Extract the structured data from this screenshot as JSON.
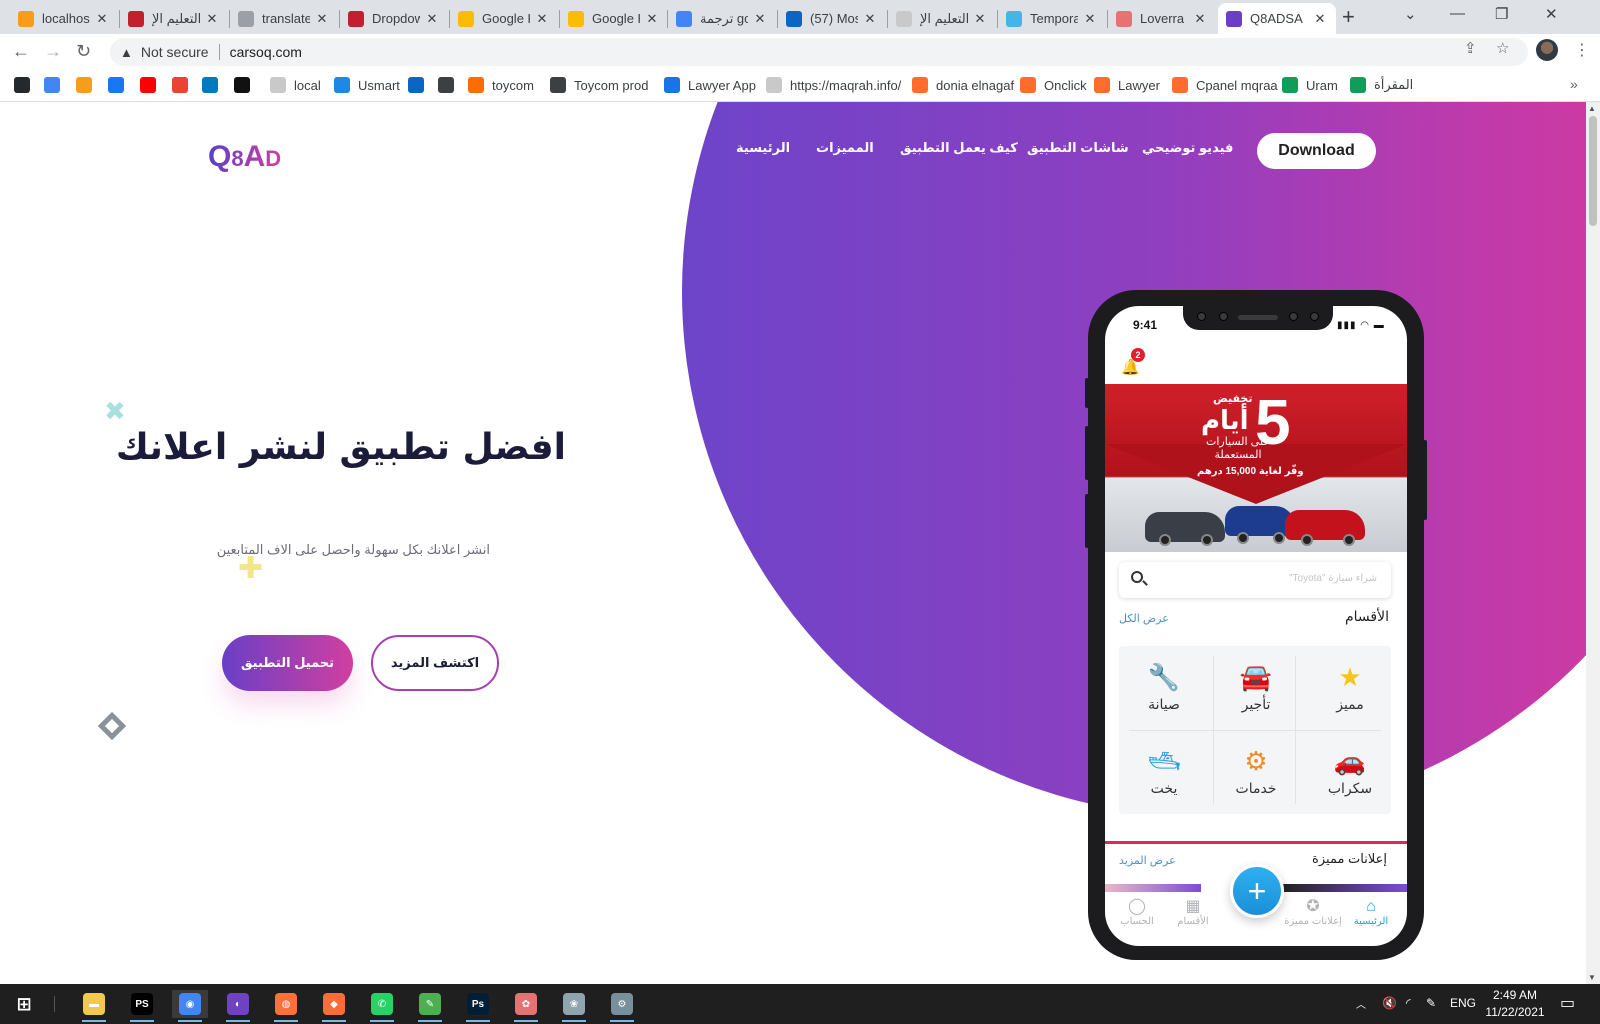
{
  "browser": {
    "tabs": [
      {
        "title": "localhost",
        "favicon": "pma-icon",
        "color": "#f89c1c"
      },
      {
        "title": "التعليم الإ",
        "favicon": "red-logo-icon",
        "color": "#c3202f"
      },
      {
        "title": "translate",
        "favicon": "translate-icon",
        "color": "#9aa0a6"
      },
      {
        "title": "Dropdown",
        "favicon": "red-logo-icon",
        "color": "#c3202f"
      },
      {
        "title": "Google K",
        "favicon": "keep-icon",
        "color": "#fbbc04"
      },
      {
        "title": "Google K",
        "favicon": "keep-icon",
        "color": "#fbbc04"
      },
      {
        "title": "ترجمة google",
        "favicon": "google-translate-icon",
        "color": "#4285f4"
      },
      {
        "title": "(57) Mos",
        "favicon": "linkedin-icon",
        "color": "#0a66c2"
      },
      {
        "title": "التعليم الإ",
        "favicon": "crown-icon",
        "color": "#c9c9c9"
      },
      {
        "title": "Tempora",
        "favicon": "temp-icon",
        "color": "#45b5e8"
      },
      {
        "title": "Loverra",
        "favicon": "page-icon",
        "color": "#e57373"
      },
      {
        "title": "Q8ADSA",
        "favicon": "q8-icon",
        "color": "#6a3fc6",
        "active": true
      }
    ],
    "new_tab_label": "+",
    "address": {
      "security": "Not secure",
      "url": "carsoq.com"
    },
    "bookmarks": [
      {
        "label": "",
        "icon": "github-icon",
        "color": "#24292e"
      },
      {
        "label": "",
        "icon": "google-translate-icon",
        "color": "#4285f4"
      },
      {
        "label": "",
        "icon": "pma-icon",
        "color": "#f89c1c"
      },
      {
        "label": "",
        "icon": "facebook-icon",
        "color": "#1877f2"
      },
      {
        "label": "",
        "icon": "youtube-icon",
        "color": "#ff0000"
      },
      {
        "label": "",
        "icon": "gmail-icon",
        "color": "#ea4335"
      },
      {
        "label": "",
        "icon": "trello-icon",
        "color": "#0079bf"
      },
      {
        "label": "",
        "icon": "notion-icon",
        "color": "#111111"
      },
      {
        "label": "local",
        "icon": "crown-icon",
        "color": "#c9c9c9"
      },
      {
        "label": "Usmart",
        "icon": "usmart-icon",
        "color": "#1e88e5"
      },
      {
        "label": "",
        "icon": "linkedin-icon",
        "color": "#0a66c2"
      },
      {
        "label": "",
        "icon": "p-icon",
        "color": "#3c4043"
      },
      {
        "label": "toycom",
        "icon": "toycom-icon",
        "color": "#ff6d00"
      },
      {
        "label": "Toycom prod",
        "icon": "globe-icon",
        "color": "#3c4043"
      },
      {
        "label": "Lawyer App",
        "icon": "lawyer-icon",
        "color": "#1a73e8"
      },
      {
        "label": "https://maqrah.info/",
        "icon": "crown-icon",
        "color": "#c9c9c9"
      },
      {
        "label": "donia elnagaf",
        "icon": "cpanel-icon",
        "color": "#ff6c2c"
      },
      {
        "label": "Onclick",
        "icon": "cpanel-icon",
        "color": "#ff6c2c"
      },
      {
        "label": "Lawyer",
        "icon": "cpanel-icon",
        "color": "#ff6c2c"
      },
      {
        "label": "Cpanel mqraa",
        "icon": "cpanel-icon",
        "color": "#ff6c2c"
      },
      {
        "label": "Uram",
        "icon": "sheets-icon",
        "color": "#0f9d58"
      },
      {
        "label": "المقرأة",
        "icon": "sheets-icon",
        "color": "#0f9d58"
      }
    ]
  },
  "site": {
    "logo": {
      "main": "Q",
      "mid": "8",
      "a": "A",
      "d": "D"
    },
    "nav": [
      {
        "label": "الرئيسية"
      },
      {
        "label": "المميزات"
      },
      {
        "label": "كيف يعمل التطبيق"
      },
      {
        "label": "شاشات التطبيق"
      },
      {
        "label": "فيديو توضيحي"
      }
    ],
    "download_label": "Download",
    "hero": {
      "title": "افضل تطبيق لنشر اعلانك",
      "subtitle": "انشر اعلانك بكل سهولة واحصل على الاف المتابعين",
      "primary_btn": "تحميل التطبيق",
      "secondary_btn": "اكتشف المزيد"
    },
    "colors": {
      "gradient_start": "#6d44c9",
      "gradient_end": "#db3c97",
      "title": "#1b1b3a"
    }
  },
  "phone": {
    "time": "9:41",
    "status_icons": "▮▮▮ ◠ ▬",
    "notifications": "2",
    "banner": {
      "tag": "تخفيض",
      "number": "5",
      "days": "أيام",
      "subtitle": "على السيارات المستعملة",
      "offer": "وفّر لغاية 15,000 درهم"
    },
    "search_placeholder": "شراء سيارة \"Toyota\"",
    "categories_title": "الأقسام",
    "categories_link": "عرض الكل",
    "categories": [
      {
        "label": "مميز",
        "icon": "star-icon",
        "glyph": "★",
        "color": "#f5c518"
      },
      {
        "label": "تأجير",
        "icon": "car-key-icon",
        "glyph": "🚘",
        "color": "#e24a3b"
      },
      {
        "label": "صيانة",
        "icon": "wrench-icon",
        "glyph": "🔧",
        "color": "#f08a24"
      },
      {
        "label": "سكراب",
        "icon": "car-icon",
        "glyph": "🚗",
        "color": "#3d4a5c"
      },
      {
        "label": "خدمات",
        "icon": "gears-icon",
        "glyph": "⚙",
        "color": "#f08a24"
      },
      {
        "label": "يخت",
        "icon": "yacht-icon",
        "glyph": "🛥",
        "color": "#2a9ee0"
      }
    ],
    "featured_title": "إعلانات مميزة",
    "featured_link": "عرض المزيد",
    "fab_label": "+",
    "bottom_nav": [
      {
        "label": "الرئيسية",
        "icon": "home-icon",
        "glyph": "⌂",
        "active": true
      },
      {
        "label": "إعلانات مميزة",
        "icon": "featured-icon",
        "glyph": "✪",
        "active": false
      },
      {
        "label": "الأقسام",
        "icon": "grid-icon",
        "glyph": "▦",
        "active": false
      },
      {
        "label": "الحساب",
        "icon": "user-icon",
        "glyph": "◯",
        "active": false
      }
    ]
  },
  "taskbar": {
    "apps": [
      {
        "icon": "windows-start-icon",
        "glyph": "⊞",
        "color": "#1f1f1f"
      },
      {
        "icon": "file-explorer-icon",
        "glyph": "▬",
        "color": "#f2c94c"
      },
      {
        "icon": "phpstorm-icon",
        "glyph": "PS",
        "color": "#000000"
      },
      {
        "icon": "chrome-icon",
        "glyph": "◉",
        "color": "#4285f4"
      },
      {
        "icon": "github-desktop-icon",
        "glyph": "◐",
        "color": "#6f42c1"
      },
      {
        "icon": "firefox-icon",
        "glyph": "◍",
        "color": "#ff7139"
      },
      {
        "icon": "postman-icon",
        "glyph": "◆",
        "color": "#ff6c37"
      },
      {
        "icon": "whatsapp-icon",
        "glyph": "✆",
        "color": "#25d366"
      },
      {
        "icon": "notepad-icon",
        "glyph": "✎",
        "color": "#4caf50"
      },
      {
        "icon": "photoshop-icon",
        "glyph": "Ps",
        "color": "#001e36"
      },
      {
        "icon": "paint-icon",
        "glyph": "✿",
        "color": "#e57373"
      },
      {
        "icon": "paint-3d-icon",
        "glyph": "❀",
        "color": "#90a4ae"
      },
      {
        "icon": "settings-app-icon",
        "glyph": "⚙",
        "color": "#78909c"
      }
    ],
    "language": "ENG",
    "time": "2:49 AM",
    "date": "11/22/2021"
  }
}
